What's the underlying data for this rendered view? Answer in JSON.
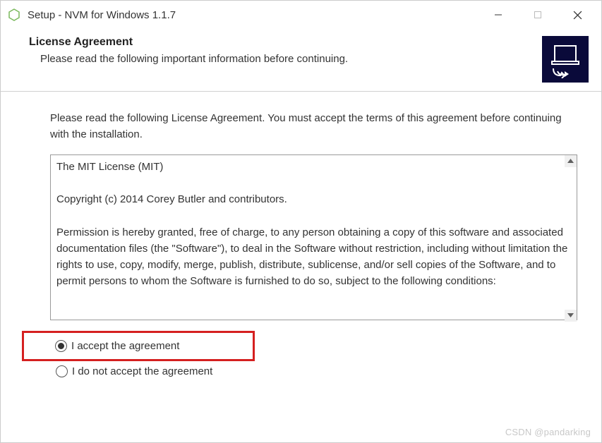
{
  "titlebar": {
    "title": "Setup - NVM for Windows 1.1.7"
  },
  "header": {
    "title": "License Agreement",
    "subtitle": "Please read the following important information before continuing."
  },
  "content": {
    "instruction": "Please read the following License Agreement. You must accept the terms of this agreement before continuing with the installation.",
    "license_text": "The MIT License (MIT)\n\nCopyright (c) 2014 Corey Butler and contributors.\n\nPermission is hereby granted, free of charge, to any person obtaining a copy of this software and associated documentation files (the \"Software\"), to deal in the Software without restriction, including without limitation the rights to use, copy, modify, merge, publish, distribute, sublicense, and/or sell copies of the Software, and to permit persons to whom the Software is furnished to do so, subject to the following conditions:"
  },
  "radios": {
    "accept_label": "I accept the agreement",
    "reject_label": "I do not accept the agreement",
    "selected": "accept"
  },
  "watermark": "CSDN @pandarking"
}
